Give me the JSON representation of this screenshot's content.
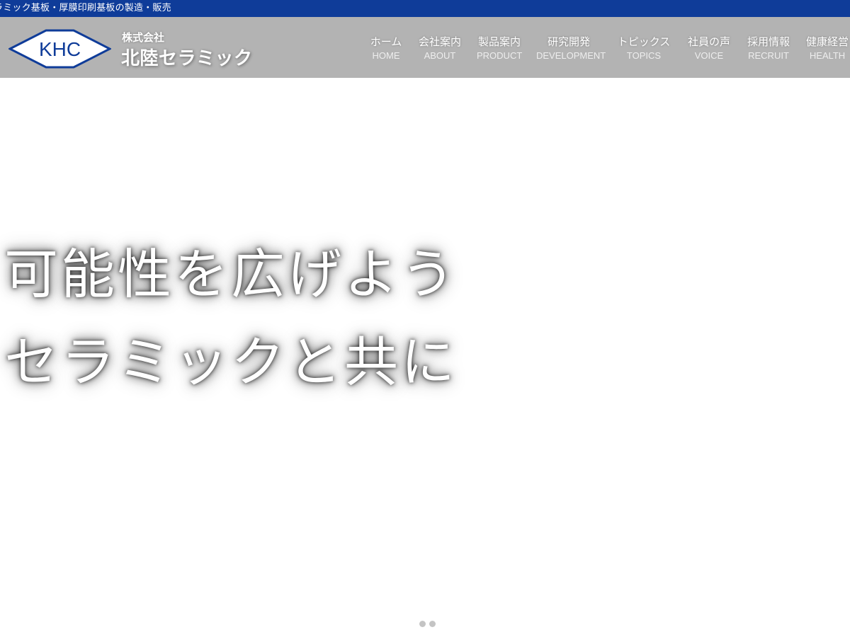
{
  "topbar": {
    "tagline": "ラミック基板・厚膜印刷基板の製造・販売"
  },
  "header": {
    "logo_text": "KHC",
    "company_type": "株式会社",
    "company_name": "北陸セラミック",
    "brand_color": "#0f3c99",
    "header_color": "#b3b3b3"
  },
  "nav": {
    "items": [
      {
        "ja": "ホーム",
        "en": "HOME"
      },
      {
        "ja": "会社案内",
        "en": "ABOUT"
      },
      {
        "ja": "製品案内",
        "en": "PRODUCT"
      },
      {
        "ja": "研究開発",
        "en": "DEVELOPMENT"
      },
      {
        "ja": "トピックス",
        "en": "TOPICS"
      },
      {
        "ja": "社員の声",
        "en": "VOICE"
      },
      {
        "ja": "採用情報",
        "en": "RECRUIT"
      },
      {
        "ja": "健康経営",
        "en": "HEALTH"
      }
    ]
  },
  "hero": {
    "line1": "可能性を広げよう",
    "line2": "セラミックと共に",
    "slides": 2
  }
}
